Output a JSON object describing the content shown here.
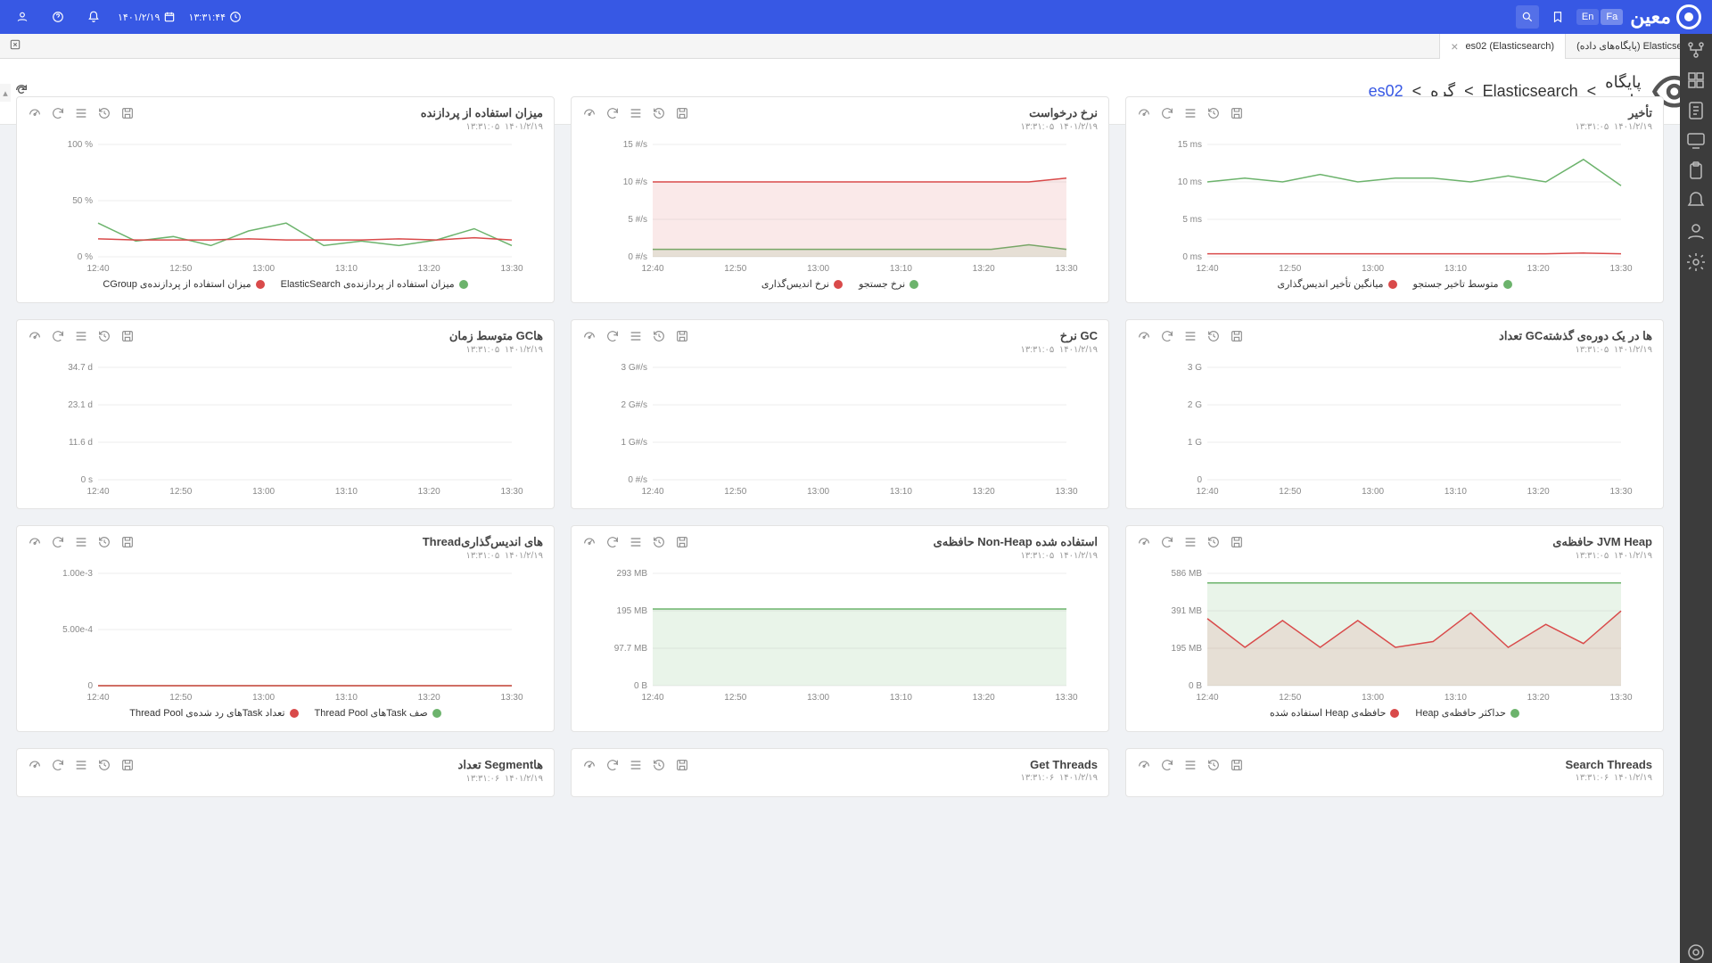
{
  "header": {
    "date": "۱۴۰۱/۲/۱۹",
    "time": "۱۳:۳۱:۴۴",
    "lang_en": "En",
    "lang_fa": "Fa",
    "brand": "معین"
  },
  "tabs": [
    {
      "label": "Elasticsearch (پایگاه‌های داده)",
      "active": false
    },
    {
      "label": "es02 (Elasticsearch)",
      "active": true
    }
  ],
  "breadcrumb": {
    "root": "پایگاه داده",
    "db": "Elasticsearch",
    "node_key": "گره",
    "node_val": "es02"
  },
  "card_timestamp": {
    "date": "۱۴۰۱/۲/۱۹",
    "time": "۱۳:۳۱:۰۵"
  },
  "card_timestamp2": {
    "date": "۱۴۰۱/۲/۱۹",
    "time": "۱۳:۳۱:۰۶"
  },
  "x_ticks": [
    "12:40",
    "12:50",
    "13:00",
    "13:10",
    "13:20",
    "13:30"
  ],
  "cards": [
    {
      "id": "latency",
      "title": "تأخیر",
      "ylabels": [
        "0 ms",
        "5 ms",
        "10 ms",
        "15 ms"
      ],
      "legend": [
        {
          "cls": "green",
          "label": "متوسط تاخیر جستجو"
        },
        {
          "cls": "red",
          "label": "میانگین تأخیر اندیس‌گذاری"
        }
      ]
    },
    {
      "id": "req",
      "title": "نرخ درخواست",
      "ylabels": [
        "0 #/s",
        "5 #/s",
        "10 #/s",
        "15 #/s"
      ],
      "legend": [
        {
          "cls": "green",
          "label": "نرخ جستجو"
        },
        {
          "cls": "red",
          "label": "نرخ اندیس‌گذاری"
        }
      ]
    },
    {
      "id": "cpu",
      "title": "میزان استفاده از پردازنده",
      "ylabels": [
        "0 %",
        "50 %",
        "100 %"
      ],
      "legend": [
        {
          "cls": "green",
          "label": "میزان استفاده از پردازنده‌ی ElasticSearch"
        },
        {
          "cls": "red",
          "label": "میزان استفاده از پردازنده‌ی CGroup"
        }
      ]
    },
    {
      "id": "gccount",
      "title": "تعداد GCها در یک دوره‌ی گذشته",
      "ylabels": [
        "0",
        "1 G",
        "2 G",
        "3 G"
      ],
      "legend": []
    },
    {
      "id": "gcrate",
      "title": "نرخ GC",
      "ylabels": [
        "0 #/s",
        "1 G#/s",
        "2 G#/s",
        "3 G#/s"
      ],
      "legend": []
    },
    {
      "id": "gctime",
      "title": "متوسط زمان GCها",
      "ylabels": [
        "0 s",
        "11.6 d",
        "23.1 d",
        "34.7 d"
      ],
      "legend": []
    },
    {
      "id": "heap",
      "title": "حافظه‌ی JVM Heap",
      "ylabels": [
        "0 B",
        "195 MB",
        "391 MB",
        "586 MB"
      ],
      "legend": [
        {
          "cls": "green",
          "label": "حداکثر حافظه‌ی Heap"
        },
        {
          "cls": "red",
          "label": "حافظه‌ی Heap استفاده شده"
        }
      ]
    },
    {
      "id": "nonheap",
      "title": "حافظه‌ی Non-Heap استفاده شده",
      "ylabels": [
        "0 B",
        "97.7 MB",
        "195 MB",
        "293 MB"
      ],
      "legend": []
    },
    {
      "id": "threads",
      "title": "Threadهای اندیس‌گذاری",
      "ylabels": [
        "0",
        "5.00e-4",
        "1.00e-3"
      ],
      "legend": [
        {
          "cls": "green",
          "label": "صف Taskهای Thread Pool"
        },
        {
          "cls": "red",
          "label": "تعداد Taskهای رد شده‌ی Thread Pool"
        }
      ]
    },
    {
      "id": "searchthreads",
      "title": "Search Threads",
      "small": true,
      "ts": "2"
    },
    {
      "id": "getthreads",
      "title": "Get Threads",
      "small": true,
      "ts": "2"
    },
    {
      "id": "segments",
      "title": "تعداد Segmentها",
      "small": true,
      "ts": "2"
    }
  ],
  "chart_data": [
    {
      "id": "latency",
      "type": "line",
      "xlabel": "",
      "ylabel": "",
      "x": [
        "12:40",
        "12:50",
        "13:00",
        "13:10",
        "13:20",
        "13:30"
      ],
      "ylim": [
        0,
        15
      ],
      "series": [
        {
          "name": "متوسط تاخیر جستجو",
          "color": "#6cb36c",
          "values": [
            10,
            10.5,
            10,
            11,
            10,
            10.5,
            10.5,
            10,
            10.8,
            10,
            13,
            9.5
          ]
        },
        {
          "name": "میانگین تأخیر اندیس‌گذاری",
          "color": "#d94a4a",
          "values": [
            0.4,
            0.4,
            0.4,
            0.4,
            0.4,
            0.4,
            0.4,
            0.4,
            0.4,
            0.4,
            0.5,
            0.4
          ]
        }
      ]
    },
    {
      "id": "req",
      "type": "line",
      "x": [
        "12:40",
        "12:50",
        "13:00",
        "13:10",
        "13:20",
        "13:30"
      ],
      "ylim": [
        0,
        15
      ],
      "series": [
        {
          "name": "نرخ جستجو",
          "color": "#6cb36c",
          "values": [
            1,
            1,
            1,
            1,
            1,
            1,
            1,
            1,
            1,
            1,
            1.6,
            1
          ]
        },
        {
          "name": "نرخ اندیس‌گذاری",
          "color": "#d94a4a",
          "values": [
            10,
            10,
            10,
            10,
            10,
            10,
            10,
            10,
            10,
            10,
            10,
            10.5
          ]
        }
      ]
    },
    {
      "id": "cpu",
      "type": "line",
      "x": [
        "12:40",
        "12:50",
        "13:00",
        "13:10",
        "13:20",
        "13:30"
      ],
      "ylim": [
        0,
        100
      ],
      "series": [
        {
          "name": "ElasticSearch",
          "color": "#6cb36c",
          "values": [
            30,
            14,
            18,
            10,
            23,
            30,
            10,
            14,
            10,
            15,
            25,
            10
          ]
        },
        {
          "name": "CGroup",
          "color": "#d94a4a",
          "values": [
            16,
            15,
            15,
            15,
            16,
            15,
            15,
            15,
            16,
            15,
            17,
            15
          ]
        }
      ]
    },
    {
      "id": "gccount",
      "type": "line",
      "ylim": [
        0,
        3
      ],
      "series": []
    },
    {
      "id": "gcrate",
      "type": "line",
      "ylim": [
        0,
        3
      ],
      "series": []
    },
    {
      "id": "gctime",
      "type": "line",
      "ylim": [
        0,
        34.7
      ],
      "series": []
    },
    {
      "id": "heap",
      "type": "area",
      "x": [
        "12:40",
        "12:50",
        "13:00",
        "13:10",
        "13:20",
        "13:30"
      ],
      "ylim": [
        0,
        586
      ],
      "series": [
        {
          "name": "حداکثر حافظه‌ی Heap",
          "color": "#6cb36c",
          "values": [
            536,
            536,
            536,
            536,
            536,
            536,
            536,
            536,
            536,
            536,
            536,
            536
          ]
        },
        {
          "name": "حافظه‌ی Heap استفاده شده",
          "color": "#d94a4a",
          "values": [
            350,
            200,
            340,
            200,
            340,
            200,
            230,
            380,
            200,
            320,
            220,
            390
          ]
        }
      ]
    },
    {
      "id": "nonheap",
      "type": "area",
      "x": [
        "12:40",
        "12:50",
        "13:00",
        "13:10",
        "13:20",
        "13:30"
      ],
      "ylim": [
        0,
        293
      ],
      "series": [
        {
          "name": "Non-Heap",
          "color": "#6cb36c",
          "values": [
            200,
            200,
            200,
            200,
            200,
            200,
            200,
            200,
            200,
            200,
            200,
            200
          ]
        }
      ]
    },
    {
      "id": "threads",
      "type": "line",
      "x": [
        "12:40",
        "12:50",
        "13:00",
        "13:10",
        "13:20",
        "13:30"
      ],
      "ylim": [
        0,
        0.001
      ],
      "series": [
        {
          "name": "صف",
          "color": "#6cb36c",
          "values": [
            0,
            0,
            0,
            0,
            0,
            0,
            0,
            0,
            0,
            0,
            0,
            0
          ]
        },
        {
          "name": "رد شده",
          "color": "#d94a4a",
          "values": [
            0,
            0,
            0,
            0,
            0,
            0,
            0,
            0,
            0,
            0,
            0,
            0
          ]
        }
      ]
    }
  ]
}
